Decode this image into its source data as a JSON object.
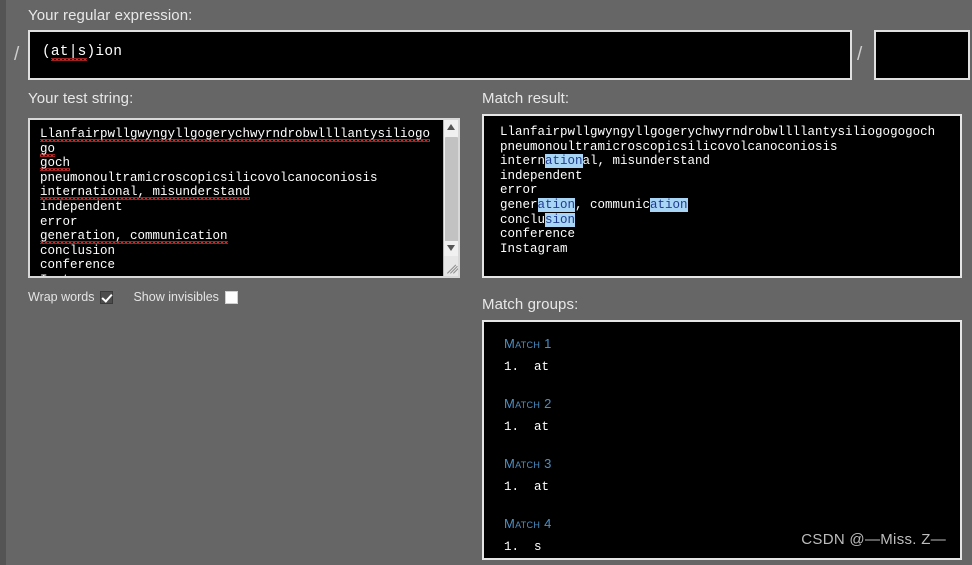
{
  "regex_section": {
    "label": "Your regular expression:",
    "slash_left": "/",
    "slash_right": "/",
    "pattern_pre": "(",
    "pattern_marked": "at|s",
    "pattern_post": ")ion",
    "pattern_full": "(at|s)ion",
    "flags_value": "",
    "flags_placeholder": ""
  },
  "test_string_section": {
    "label": "Your test string:",
    "lines": [
      "Llanfairpwllgwyngyllgogerychwyrndrobwllllantysiliogogo",
      "goch",
      "pneumonoultramicroscopicsilicovolcanoconiosis",
      "international, misunderstand",
      "independent",
      "error",
      "generation, communication",
      "conclusion",
      "conference",
      "Instagram"
    ],
    "options": [
      {
        "label": "Wrap words",
        "checked": true
      },
      {
        "label": "Show invisibles",
        "checked": false
      }
    ]
  },
  "match_result_section": {
    "label": "Match result:",
    "lines": [
      [
        {
          "t": "Llanfairpwllgwyngyllgogerychwyrndrobwllllantysiliogogogoch",
          "h": false
        }
      ],
      [
        {
          "t": "pneumonoultramicroscopicsilicovolcanoconiosis",
          "h": false
        }
      ],
      [
        {
          "t": "intern",
          "h": false
        },
        {
          "t": "ation",
          "h": true
        },
        {
          "t": "al, misunderstand",
          "h": false
        }
      ],
      [
        {
          "t": "independent",
          "h": false
        }
      ],
      [
        {
          "t": "error",
          "h": false
        }
      ],
      [
        {
          "t": "gener",
          "h": false
        },
        {
          "t": "ation",
          "h": true
        },
        {
          "t": ", communic",
          "h": false
        },
        {
          "t": "ation",
          "h": true
        }
      ],
      [
        {
          "t": "conclu",
          "h": false
        },
        {
          "t": "sion",
          "h": true
        }
      ],
      [
        {
          "t": "conference",
          "h": false
        }
      ],
      [
        {
          "t": "Instagram",
          "h": false
        }
      ]
    ],
    "highlight_bg": "#a8d4f5",
    "highlight_fg": "#1f3d8f"
  },
  "match_groups_section": {
    "label": "Match groups:",
    "groups": [
      {
        "title": "Match 1",
        "items": [
          "1.  at"
        ]
      },
      {
        "title": "Match 2",
        "items": [
          "1.  at"
        ]
      },
      {
        "title": "Match 3",
        "items": [
          "1.  at"
        ]
      },
      {
        "title": "Match 4",
        "items": [
          "1.  s"
        ]
      }
    ],
    "title_color": "#4d8fc4"
  },
  "watermark": "CSDN @—Miss. Z—",
  "theme": {
    "page_bg": "#666666",
    "field_bg": "#000000",
    "field_border": "#e6e6e6",
    "text_color": "#ffffff",
    "label_color": "#e8e8e8",
    "spellcheck_underline": "#d02b2b"
  }
}
